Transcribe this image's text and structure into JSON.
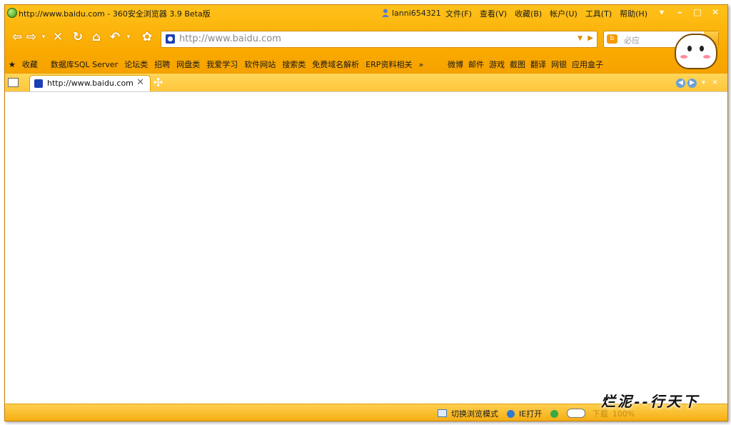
{
  "window": {
    "title": "http://www.baidu.com - 360安全浏览器 3.9 Beta版",
    "user": "lanni654321",
    "menu": [
      "文件(F)",
      "查看(V)",
      "收藏(B)",
      "帐户(U)",
      "工具(T)",
      "帮助(H)"
    ],
    "controls": [
      "▾",
      "–",
      "□",
      "✕"
    ]
  },
  "navigation": {
    "back": "⇦",
    "forward": "⇨",
    "stop": "✕",
    "refresh": "↻",
    "home": "⌂",
    "undo": "↶",
    "address": "http://www.baidu.com",
    "search_placeholder": "必应"
  },
  "bookmarks": {
    "left": [
      "收藏",
      "数据库SQL Server",
      "论坛类",
      "招聘",
      "网盘类",
      "我爱学习",
      "软件网站",
      "搜索类",
      "免费域名解析",
      "ERP资料相关",
      "»"
    ],
    "right": [
      "微博",
      "邮件",
      "游戏",
      "截图",
      "翻译",
      "网银",
      "应用盒子"
    ]
  },
  "tabs": [
    {
      "label": "http://www.baidu.com",
      "close": "✕"
    }
  ],
  "statusbar": {
    "mode": "切换浏览模式",
    "ie_open": "IE打开",
    "download": "下载",
    "zoom": "100%"
  },
  "watermark": "烂泥--行天下",
  "colors": {
    "chrome": "#f7a400",
    "tabbar": "#ffc63a",
    "statusbar": "#f5ad10"
  }
}
